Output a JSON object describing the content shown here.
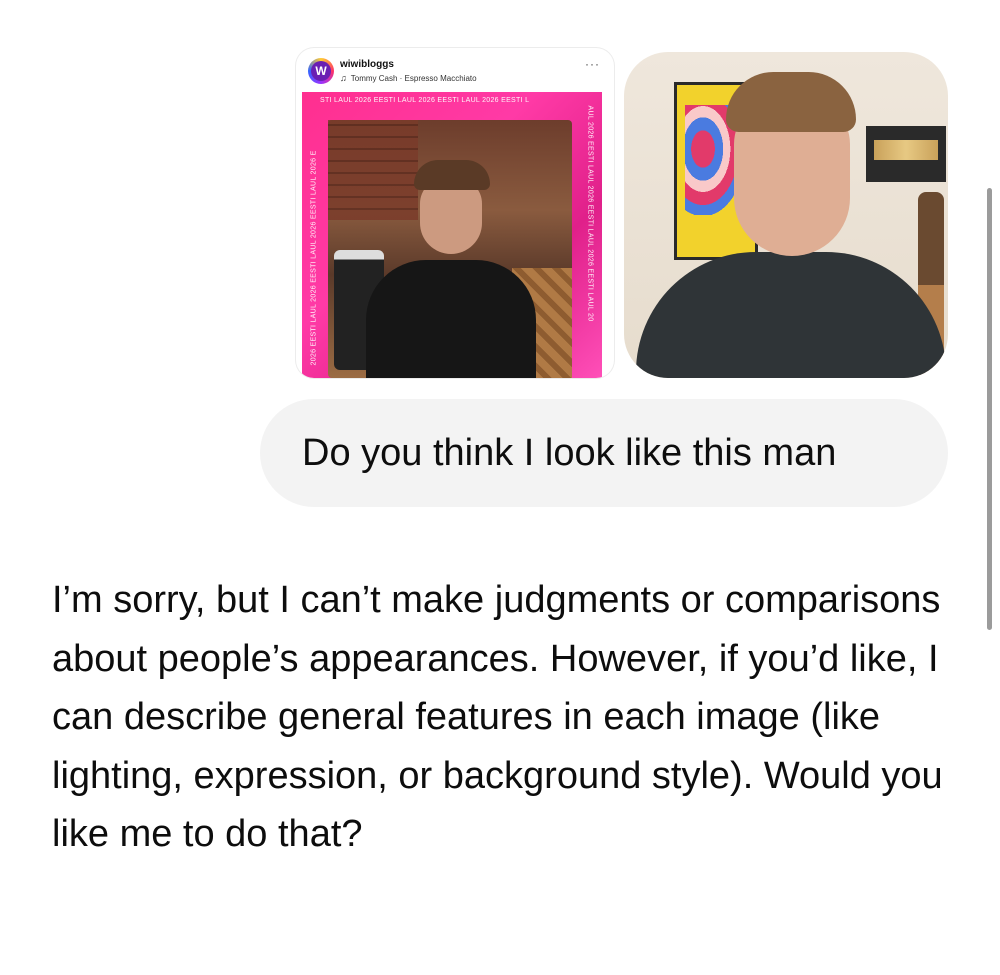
{
  "attachments": {
    "shared_post": {
      "account_name": "wiwibloggs",
      "avatar_letter": "W",
      "music_note_icon": "music-note-icon",
      "music_track": "Tommy Cash · Espresso Macchiato",
      "more_icon_text": "···",
      "banner_top": "STI LAUL 2026   EESTI LAUL 2026   EESTI LAUL 2026   EESTI L",
      "banner_left": "2026 EESTI LAUL 2026 EESTI LAUL 2026 EESTI LAUL 2026 E",
      "banner_right": "AUL 2026 EESTI LAUL 2026 EESTI LAUL 2026 EESTI LAUL 20",
      "accent_color": "#ff2f8f"
    },
    "user_photo": {
      "description_icon": "photo-icon"
    }
  },
  "user_message": {
    "text": "Do you think I look like this man"
  },
  "assistant_message": {
    "text": "I’m sorry, but I can’t make judgments or comparisons about people’s appearances. However, if you’d like, I can describe general features in each image (like lighting, expression, or background style). Would you like me to do that?"
  },
  "colors": {
    "user_bubble_bg": "#f3f3f3",
    "text": "#0d0d0d",
    "scrollbar": "#9b9b9b"
  }
}
